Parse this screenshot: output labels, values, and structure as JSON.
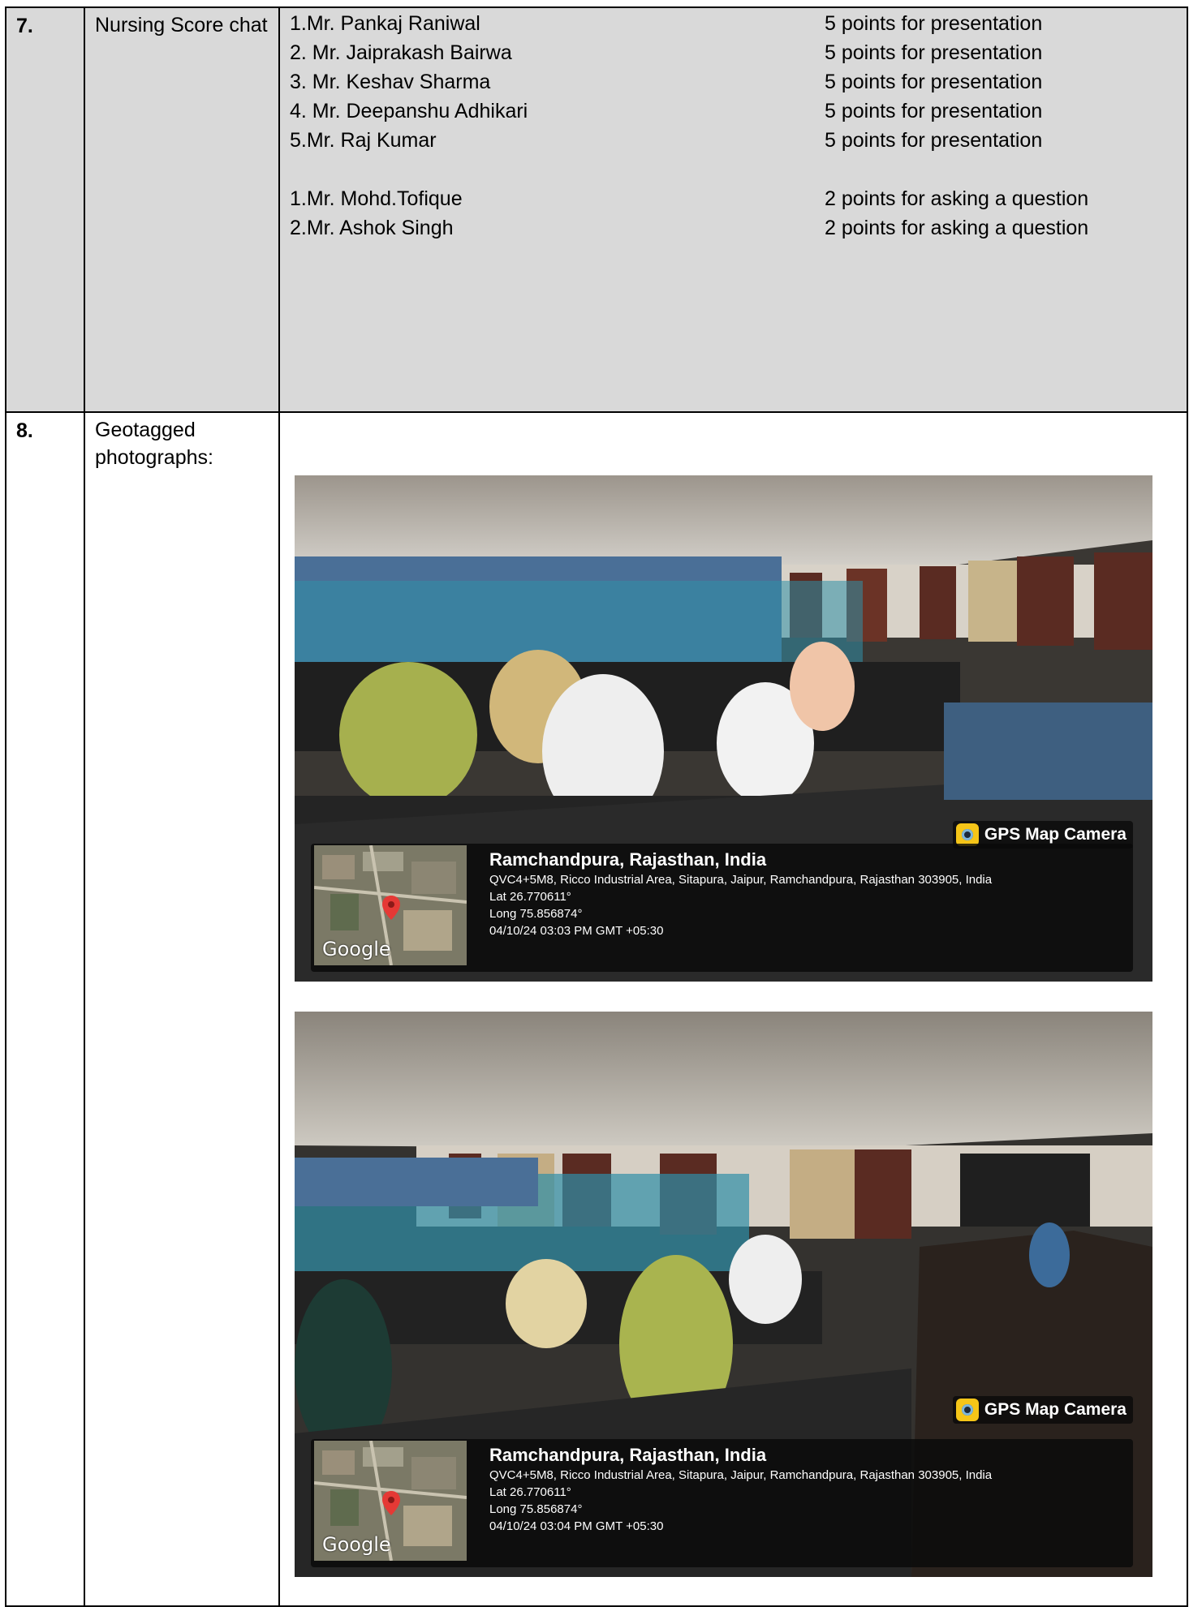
{
  "rows": [
    {
      "number": "7.",
      "label": "Nursing Score chat",
      "presenters": [
        {
          "name": "1.Mr. Pankaj Raniwal",
          "points": "5 points for presentation"
        },
        {
          "name": "2. Mr. Jaiprakash Bairwa",
          "points": "5 points for presentation"
        },
        {
          "name": "3. Mr. Keshav Sharma",
          "points": "5 points for presentation"
        },
        {
          "name": "4. Mr. Deepanshu Adhikari",
          "points": "5 points for presentation"
        },
        {
          "name": "5.Mr. Raj Kumar",
          "points": "5 points for presentation"
        }
      ],
      "questioners": [
        {
          "name": "1.Mr. Mohd.Tofique",
          "points": "2 points for asking a question"
        },
        {
          "name": "2.Mr. Ashok Singh",
          "points": "2 points for asking a question"
        }
      ]
    },
    {
      "number": "8.",
      "label": "Geotagged photographs:"
    }
  ],
  "photos": [
    {
      "badge": "GPS Map Camera",
      "map_label": "Google",
      "location_title": "Ramchandpura, Rajasthan, India",
      "address": "QVC4+5M8, Ricco Industrial Area, Sitapura, Jaipur, Ramchandpura, Rajasthan 303905, India",
      "lat": "Lat 26.770611°",
      "long": "Long 75.856874°",
      "timestamp": "04/10/24 03:03 PM GMT +05:30"
    },
    {
      "badge": "GPS Map Camera",
      "map_label": "Google",
      "location_title": "Ramchandpura, Rajasthan, India",
      "address": "QVC4+5M8, Ricco Industrial Area, Sitapura, Jaipur, Ramchandpura, Rajasthan 303905, India",
      "lat": "Lat 26.770611°",
      "long": "Long 75.856874°",
      "timestamp": "04/10/24 03:04 PM GMT +05:30"
    }
  ],
  "colors": {
    "row7_background": "#d9d9d9",
    "camera_badge_icon": "#f5c518",
    "map_pin": "#e53935"
  }
}
